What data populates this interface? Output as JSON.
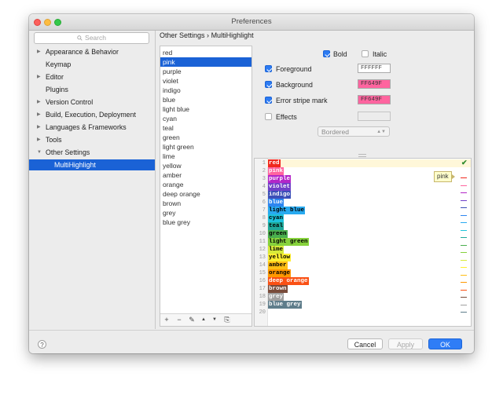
{
  "window": {
    "title": "Preferences"
  },
  "search": {
    "placeholder": "Search"
  },
  "sidebar": {
    "items": [
      {
        "label": "Appearance & Behavior",
        "expandable": true
      },
      {
        "label": "Keymap",
        "expandable": false
      },
      {
        "label": "Editor",
        "expandable": true
      },
      {
        "label": "Plugins",
        "expandable": false
      },
      {
        "label": "Version Control",
        "expandable": true
      },
      {
        "label": "Build, Execution, Deployment",
        "expandable": true
      },
      {
        "label": "Languages & Frameworks",
        "expandable": true
      },
      {
        "label": "Tools",
        "expandable": true
      },
      {
        "label": "Other Settings",
        "expandable": true,
        "expanded": true
      },
      {
        "label": "MultiHighlight",
        "selected": true
      }
    ]
  },
  "breadcrumb": {
    "parent": "Other Settings",
    "separator": "›",
    "current": "MultiHighlight"
  },
  "color_list": {
    "items": [
      "red",
      "pink",
      "purple",
      "violet",
      "indigo",
      "blue",
      "light blue",
      "cyan",
      "teal",
      "green",
      "light green",
      "lime",
      "yellow",
      "amber",
      "orange",
      "deep orange",
      "brown",
      "grey",
      "blue grey"
    ],
    "selected": "pink"
  },
  "toolbar": {
    "add": "+",
    "remove": "−",
    "edit": "✎",
    "up": "▲",
    "down": "▼",
    "copy": "⎘"
  },
  "options": {
    "bold": {
      "label": "Bold",
      "checked": true
    },
    "italic": {
      "label": "Italic",
      "checked": false
    },
    "foreground": {
      "label": "Foreground",
      "checked": true,
      "value": "FFFFFF"
    },
    "background": {
      "label": "Background",
      "checked": true,
      "value": "FF649F"
    },
    "error_stripe": {
      "label": "Error stripe mark",
      "checked": true,
      "value": "FF649F"
    },
    "effects": {
      "label": "Effects",
      "checked": false,
      "value": ""
    },
    "effect_type": "Bordered"
  },
  "preview": {
    "rows": [
      {
        "n": "1",
        "text": "red",
        "bg": "#f0281e",
        "fg": "#ffffff"
      },
      {
        "n": "2",
        "text": "pink",
        "bg": "#ff649f",
        "fg": "#ffffff"
      },
      {
        "n": "3",
        "text": "purple",
        "bg": "#b326c8",
        "fg": "#ffffff"
      },
      {
        "n": "4",
        "text": "violet",
        "bg": "#7040c8",
        "fg": "#ffffff"
      },
      {
        "n": "5",
        "text": "indigo",
        "bg": "#3b4fb8",
        "fg": "#ffffff"
      },
      {
        "n": "6",
        "text": "blue",
        "bg": "#2d86f0",
        "fg": "#ffffff"
      },
      {
        "n": "7",
        "text": "light blue",
        "bg": "#28aaf0",
        "fg": "#000000"
      },
      {
        "n": "8",
        "text": "cyan",
        "bg": "#1ec3dc",
        "fg": "#000000"
      },
      {
        "n": "9",
        "text": "teal",
        "bg": "#1fa89a",
        "fg": "#000000"
      },
      {
        "n": "10",
        "text": "green",
        "bg": "#4aaf4e",
        "fg": "#000000"
      },
      {
        "n": "11",
        "text": "light green",
        "bg": "#86d23c",
        "fg": "#000000"
      },
      {
        "n": "12",
        "text": "lime",
        "bg": "#d7ea3a",
        "fg": "#000000"
      },
      {
        "n": "13",
        "text": "yellow",
        "bg": "#ffee32",
        "fg": "#000000"
      },
      {
        "n": "14",
        "text": "amber",
        "bg": "#ffbe14",
        "fg": "#000000"
      },
      {
        "n": "15",
        "text": "orange",
        "bg": "#ff9800",
        "fg": "#000000"
      },
      {
        "n": "16",
        "text": "deep orange",
        "bg": "#fa5014",
        "fg": "#ffffff"
      },
      {
        "n": "17",
        "text": "brown",
        "bg": "#784b3a",
        "fg": "#ffffff"
      },
      {
        "n": "18",
        "text": "grey",
        "bg": "#a0a0a0",
        "fg": "#ffffff"
      },
      {
        "n": "19",
        "text": "blue grey",
        "bg": "#5f7d8b",
        "fg": "#ffffff"
      },
      {
        "n": "20",
        "text": "",
        "bg": "",
        "fg": ""
      }
    ],
    "tooltip": "pink"
  },
  "footer": {
    "help": "?",
    "cancel": "Cancel",
    "apply": "Apply",
    "ok": "OK"
  }
}
